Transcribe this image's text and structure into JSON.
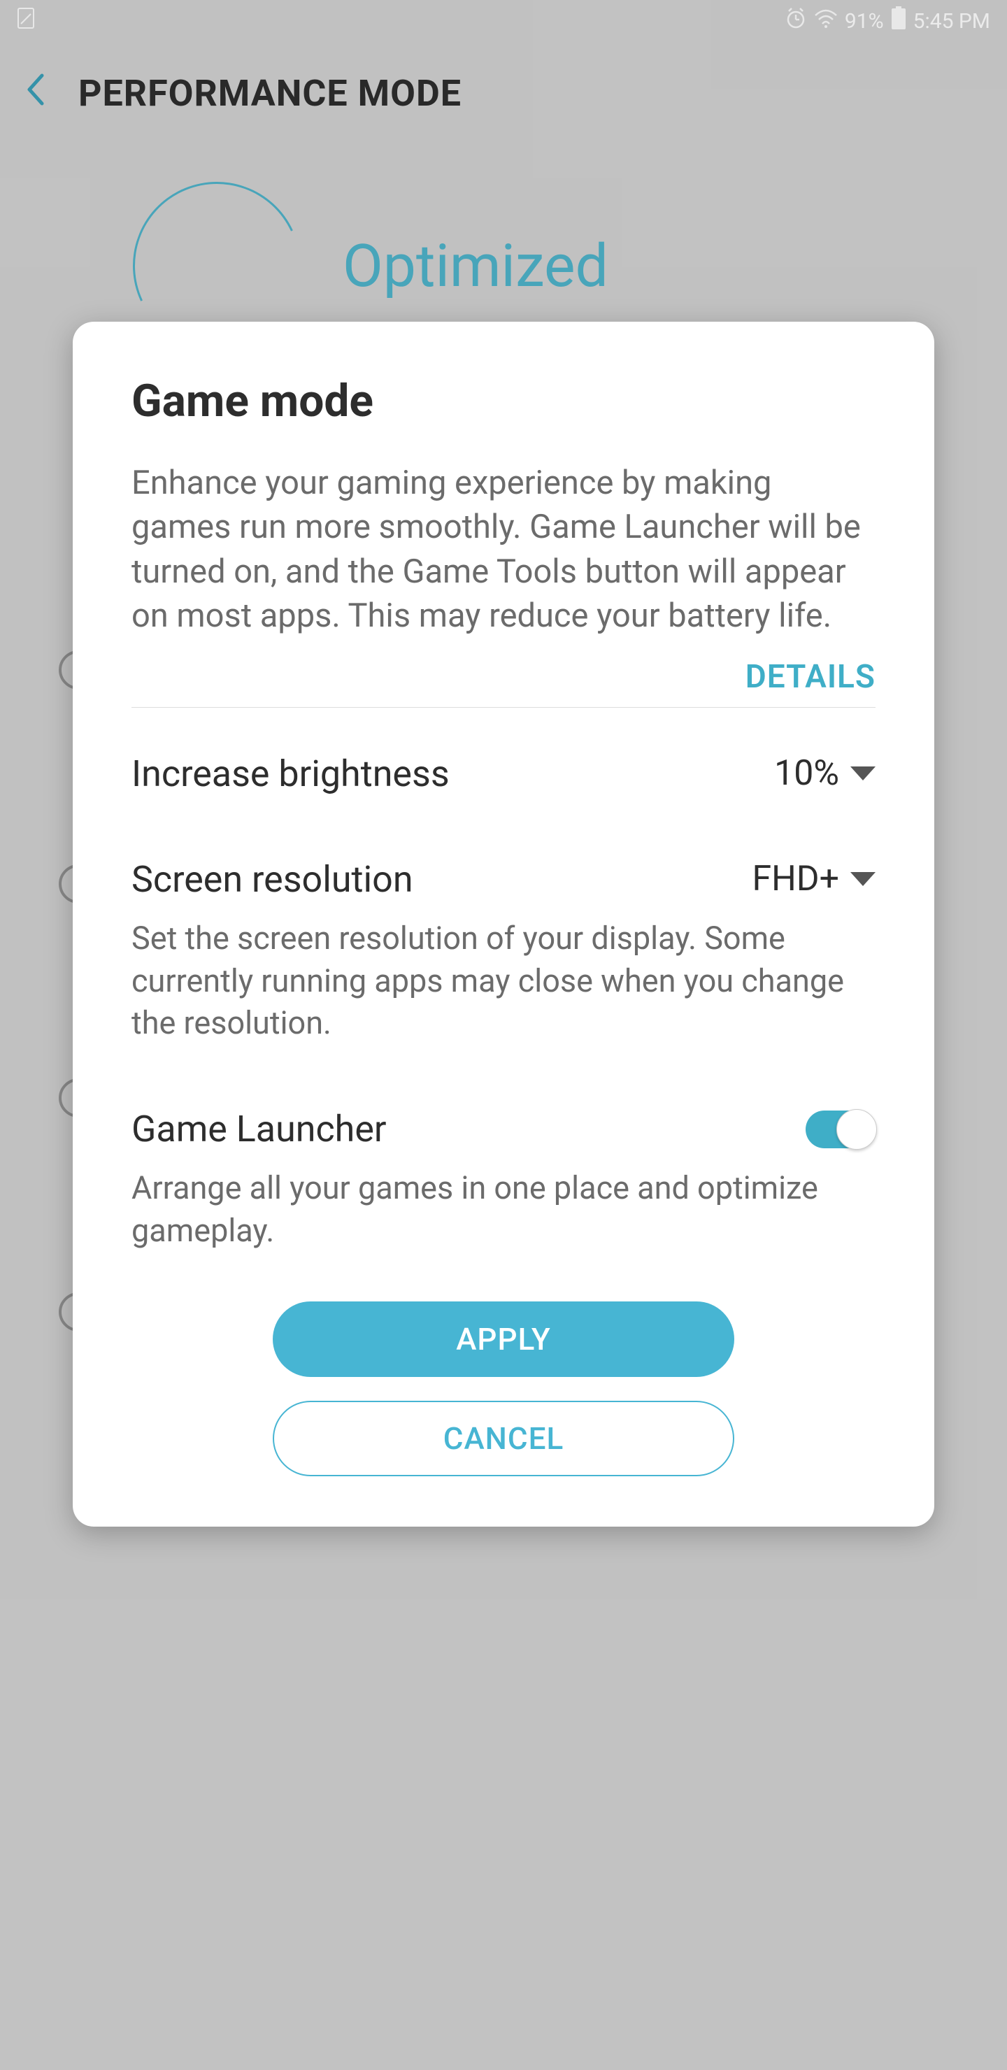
{
  "status_bar": {
    "battery_percent": "91%",
    "time": "5:45 PM"
  },
  "header": {
    "title": "PERFORMANCE MODE"
  },
  "background": {
    "mode_name": "Optimized"
  },
  "dialog": {
    "title": "Game mode",
    "description": "Enhance your gaming experience by making games run more smoothly. Game Launcher will be turned on, and the Game Tools button will appear on most apps. This may reduce your battery life.",
    "details_link": "DETAILS",
    "brightness": {
      "label": "Increase brightness",
      "value": "10%"
    },
    "resolution": {
      "label": "Screen resolution",
      "value": "FHD+",
      "description": "Set the screen resolution of your display. Some currently running apps may close when you change the resolution."
    },
    "game_launcher": {
      "label": "Game Launcher",
      "description": "Arrange all your games in one place and optimize gameplay."
    },
    "apply_button": "APPLY",
    "cancel_button": "CANCEL"
  }
}
